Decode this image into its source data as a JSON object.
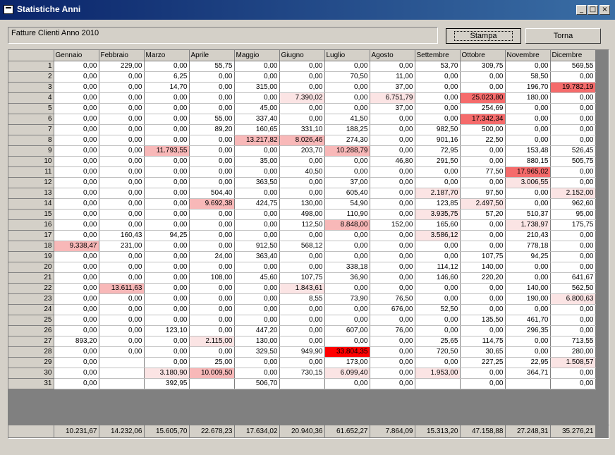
{
  "window": {
    "title": "Statistiche Anni",
    "minimize": "_",
    "maximize": "□",
    "close": "×"
  },
  "header_label": "Fatture Clienti Anno 2010",
  "buttons": {
    "stampa": "Stampa",
    "torna": "Torna"
  },
  "colors": {
    "highlight_strong": "#ff0000",
    "highlight_mid": "#f56b6b",
    "highlight_light": "#f8b8b8",
    "highlight_faint": "#fbe4e4"
  },
  "columns": [
    "Gennaio",
    "Febbraio",
    "Marzo",
    "Aprile",
    "Maggio",
    "Giugno",
    "Luglio",
    "Agosto",
    "Settembre",
    "Ottobre",
    "Novembre",
    "Dicembre"
  ],
  "rows": [
    [
      "1",
      "0,00",
      "229,00",
      "0,00",
      "55,75",
      "0,00",
      "0,00",
      "0,00",
      "0,00",
      "53,70",
      "309,75",
      "0,00",
      "569,55"
    ],
    [
      "2",
      "0,00",
      "0,00",
      "6,25",
      "0,00",
      "0,00",
      "0,00",
      "70,50",
      "11,00",
      "0,00",
      "0,00",
      "58,50",
      "0,00"
    ],
    [
      "3",
      "0,00",
      "0,00",
      "14,70",
      "0,00",
      "315,00",
      "0,00",
      "0,00",
      "37,00",
      "0,00",
      "0,00",
      "196,70",
      "19.782,19"
    ],
    [
      "4",
      "0,00",
      "0,00",
      "0,00",
      "0,00",
      "0,00",
      "7.390,02",
      "0,00",
      "6.751,79",
      "0,00",
      "25.023,80",
      "180,00",
      "0,00"
    ],
    [
      "5",
      "0,00",
      "0,00",
      "0,00",
      "0,00",
      "45,00",
      "0,00",
      "0,00",
      "37,00",
      "0,00",
      "254,69",
      "0,00",
      "0,00"
    ],
    [
      "6",
      "0,00",
      "0,00",
      "0,00",
      "55,00",
      "337,40",
      "0,00",
      "41,50",
      "0,00",
      "0,00",
      "17.342,34",
      "0,00",
      "0,00"
    ],
    [
      "7",
      "0,00",
      "0,00",
      "0,00",
      "89,20",
      "160,65",
      "331,10",
      "188,25",
      "0,00",
      "982,50",
      "500,00",
      "0,00",
      "0,00"
    ],
    [
      "8",
      "0,00",
      "0,00",
      "0,00",
      "0,00",
      "13.217,82",
      "8.026,46",
      "274,30",
      "0,00",
      "901,16",
      "22,50",
      "0,00",
      "0,00"
    ],
    [
      "9",
      "0,00",
      "0,00",
      "11.793,55",
      "0,00",
      "0,00",
      "203,70",
      "10.288,79",
      "0,00",
      "72,95",
      "0,00",
      "153,48",
      "526,45"
    ],
    [
      "10",
      "0,00",
      "0,00",
      "0,00",
      "0,00",
      "35,00",
      "0,00",
      "0,00",
      "46,80",
      "291,50",
      "0,00",
      "880,15",
      "505,75"
    ],
    [
      "11",
      "0,00",
      "0,00",
      "0,00",
      "0,00",
      "0,00",
      "40,50",
      "0,00",
      "0,00",
      "0,00",
      "77,50",
      "17.965,02",
      "0,00"
    ],
    [
      "12",
      "0,00",
      "0,00",
      "0,00",
      "0,00",
      "363,50",
      "0,00",
      "37,00",
      "0,00",
      "0,00",
      "0,00",
      "3.006,55",
      "0,00"
    ],
    [
      "13",
      "0,00",
      "0,00",
      "0,00",
      "504,40",
      "0,00",
      "0,00",
      "605,40",
      "0,00",
      "2.187,70",
      "97,50",
      "0,00",
      "2.152,00"
    ],
    [
      "14",
      "0,00",
      "0,00",
      "0,00",
      "9.692,38",
      "424,75",
      "130,00",
      "54,90",
      "0,00",
      "123,85",
      "2.497,50",
      "0,00",
      "962,60"
    ],
    [
      "15",
      "0,00",
      "0,00",
      "0,00",
      "0,00",
      "0,00",
      "498,00",
      "110,90",
      "0,00",
      "3.935,75",
      "57,20",
      "510,37",
      "95,00"
    ],
    [
      "16",
      "0,00",
      "0,00",
      "0,00",
      "0,00",
      "0,00",
      "112,50",
      "8.848,00",
      "152,00",
      "165,60",
      "0,00",
      "1.738,97",
      "175,75"
    ],
    [
      "17",
      "0,00",
      "160,43",
      "94,25",
      "0,00",
      "0,00",
      "0,00",
      "0,00",
      "0,00",
      "3.586,12",
      "0,00",
      "210,43",
      "0,00"
    ],
    [
      "18",
      "9.338,47",
      "231,00",
      "0,00",
      "0,00",
      "912,50",
      "568,12",
      "0,00",
      "0,00",
      "0,00",
      "0,00",
      "778,18",
      "0,00"
    ],
    [
      "19",
      "0,00",
      "0,00",
      "0,00",
      "24,00",
      "363,40",
      "0,00",
      "0,00",
      "0,00",
      "0,00",
      "107,75",
      "94,25",
      "0,00"
    ],
    [
      "20",
      "0,00",
      "0,00",
      "0,00",
      "0,00",
      "0,00",
      "0,00",
      "338,18",
      "0,00",
      "114,12",
      "140,00",
      "0,00",
      "0,00"
    ],
    [
      "21",
      "0,00",
      "0,00",
      "0,00",
      "108,00",
      "45,60",
      "107,75",
      "36,90",
      "0,00",
      "146,60",
      "220,20",
      "0,00",
      "641,67"
    ],
    [
      "22",
      "0,00",
      "13.611,63",
      "0,00",
      "0,00",
      "0,00",
      "1.843,61",
      "0,00",
      "0,00",
      "0,00",
      "0,00",
      "140,00",
      "562,50"
    ],
    [
      "23",
      "0,00",
      "0,00",
      "0,00",
      "0,00",
      "0,00",
      "8,55",
      "73,90",
      "76,50",
      "0,00",
      "0,00",
      "190,00",
      "6.800,63"
    ],
    [
      "24",
      "0,00",
      "0,00",
      "0,00",
      "0,00",
      "0,00",
      "0,00",
      "0,00",
      "676,00",
      "52,50",
      "0,00",
      "0,00",
      "0,00"
    ],
    [
      "25",
      "0,00",
      "0,00",
      "0,00",
      "0,00",
      "0,00",
      "0,00",
      "0,00",
      "0,00",
      "0,00",
      "135,50",
      "461,70",
      "0,00"
    ],
    [
      "26",
      "0,00",
      "0,00",
      "123,10",
      "0,00",
      "447,20",
      "0,00",
      "607,00",
      "76,00",
      "0,00",
      "0,00",
      "296,35",
      "0,00"
    ],
    [
      "27",
      "893,20",
      "0,00",
      "0,00",
      "2.115,00",
      "130,00",
      "0,00",
      "0,00",
      "0,00",
      "25,65",
      "114,75",
      "0,00",
      "713,55"
    ],
    [
      "28",
      "0,00",
      "0,00",
      "0,00",
      "0,00",
      "329,50",
      "949,90",
      "33.804,35",
      "0,00",
      "720,50",
      "30,65",
      "0,00",
      "280,00"
    ],
    [
      "29",
      "0,00",
      "",
      "0,00",
      "25,00",
      "0,00",
      "0,00",
      "173,00",
      "0,00",
      "0,00",
      "227,25",
      "22,95",
      "1.508,57"
    ],
    [
      "30",
      "0,00",
      "",
      "3.180,90",
      "10.009,50",
      "0,00",
      "730,15",
      "6.099,40",
      "0,00",
      "1.953,00",
      "0,00",
      "364,71",
      "0,00"
    ],
    [
      "31",
      "0,00",
      "",
      "392,95",
      "",
      "506,70",
      "",
      "0,00",
      "0,00",
      "",
      "0,00",
      "",
      "0,00"
    ]
  ],
  "totals": [
    "10.231,67",
    "14.232,06",
    "15.605,70",
    "22.678,23",
    "17.634,02",
    "20.940,36",
    "61.652,27",
    "7.864,09",
    "15.313,20",
    "47.158,88",
    "27.248,31",
    "35.276,21"
  ]
}
